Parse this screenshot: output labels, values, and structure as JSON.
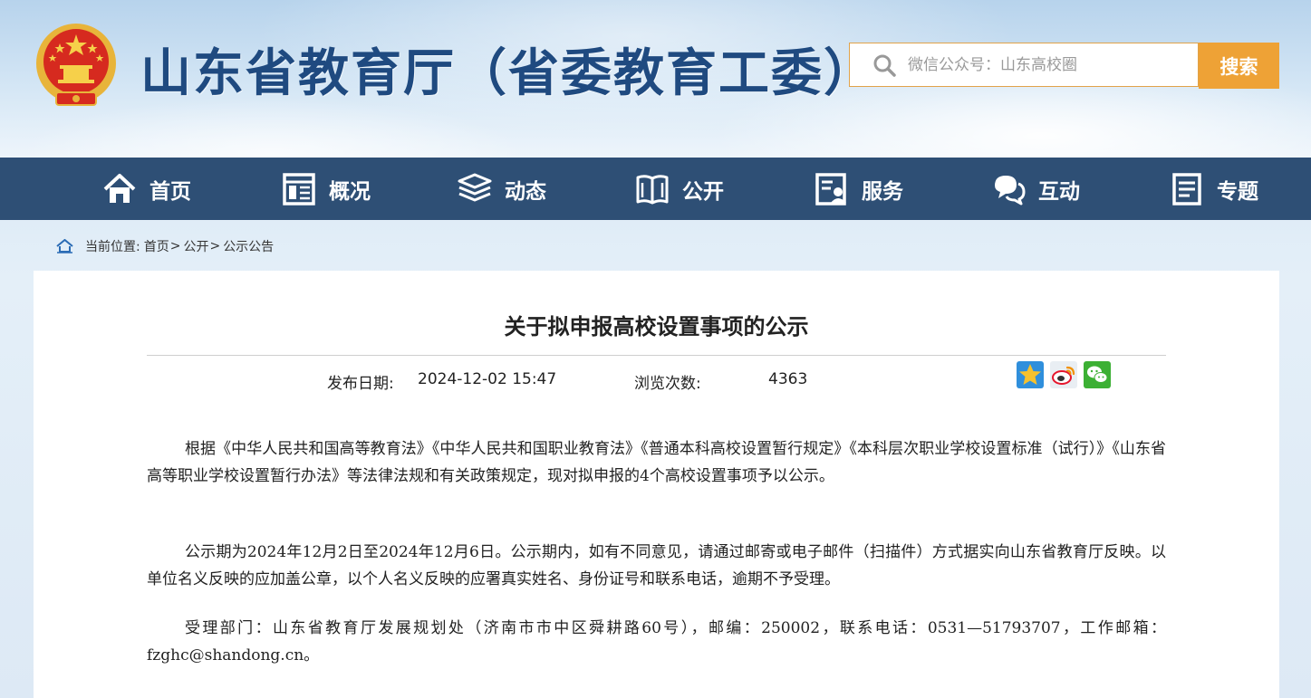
{
  "header": {
    "site_title": "山东省教育厅（省委教育工委）",
    "search_placeholder": "微信公众号：山东高校圈",
    "search_button": "搜索",
    "colors": {
      "title": "#1f4a80",
      "search_button": "#eea236",
      "search_border": "#e1a34a"
    }
  },
  "nav": {
    "background": "#2e4f75",
    "items": [
      {
        "label": "首页",
        "icon": "home-icon"
      },
      {
        "label": "概况",
        "icon": "overview-icon"
      },
      {
        "label": "动态",
        "icon": "layers-icon"
      },
      {
        "label": "公开",
        "icon": "book-icon"
      },
      {
        "label": "服务",
        "icon": "service-icon"
      },
      {
        "label": "互动",
        "icon": "chat-icon"
      },
      {
        "label": "专题",
        "icon": "document-icon"
      }
    ]
  },
  "breadcrumb": {
    "prefix": "当前位置:",
    "items": [
      "首页",
      "公开",
      "公示公告"
    ],
    "separator": ">"
  },
  "article": {
    "title": "关于拟申报高校设置事项的公示",
    "date_label": "发布日期:",
    "date_value": "2024-12-02 15:47",
    "views_label": "浏览次数:",
    "views_value": "4363",
    "share_icons": [
      "qzone-icon",
      "weibo-icon",
      "wechat-icon"
    ],
    "paragraphs": [
      "根据《中华人民共和国高等教育法》《中华人民共和国职业教育法》《普通本科高校设置暂行规定》《本科层次职业学校设置标准（试行）》《山东省高等职业学校设置暂行办法》等法律法规和有关政策规定，现对拟申报的4个高校设置事项予以公示。",
      "公示期为2024年12月2日至2024年12月6日。公示期内，如有不同意见，请通过邮寄或电子邮件（扫描件）方式据实向山东省教育厅反映。以单位名义反映的应加盖公章，以个人名义反映的应署真实姓名、身份证号和联系电话，逾期不予受理。",
      "受理部门：山东省教育厅发展规划处（济南市市中区舜耕路60号），邮编：250002，联系电话：0531—51793707，工作邮箱：fzghc@shandong.cn。"
    ]
  }
}
